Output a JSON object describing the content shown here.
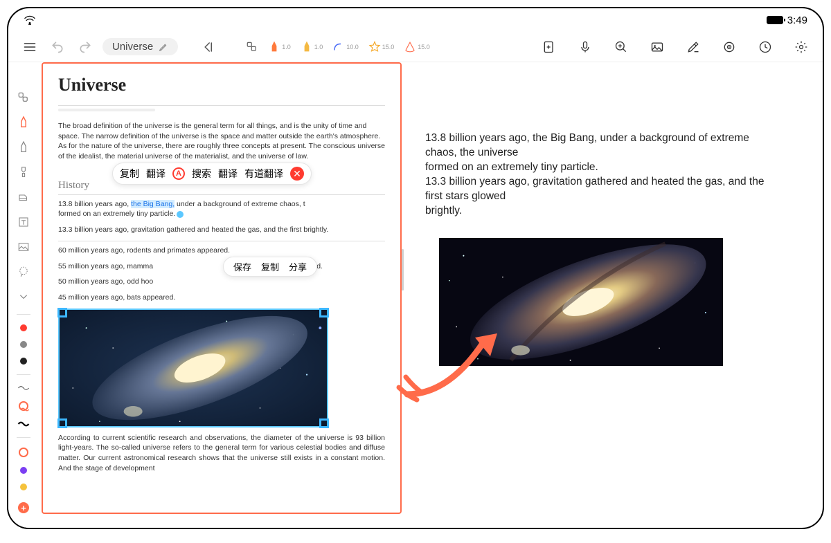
{
  "status": {
    "time": "3:49"
  },
  "doc": {
    "title": "Universe"
  },
  "toolSizes": {
    "pen1": "1.0",
    "pen2": "1.0",
    "curve": "10.0",
    "star": "15.0",
    "cone": "15.0"
  },
  "page": {
    "h1": "Universe",
    "intro": "The broad definition of the universe is the general term for all things, and is the unity of time and space. The narrow definition of the universe is the space and matter outside the earth's atmosphere. As for the nature of the universe, there are roughly three concepts at present. The conscious universe of the idealist, the material universe of the materialist, and the universe of law.",
    "h2": "History",
    "p1a": "13.8 billion years ago, ",
    "p1link": "the Big Bang,",
    "p1b": " under a background of extreme chaos, t",
    "p1c": "formed on an extremely tiny particle.",
    "p2": "13.3 billion years ago, gravitation gathered and heated the gas, and the first brightly.",
    "t1": "60 million years ago, rodents and primates appeared.",
    "t2a": "55 million years ago, mamma",
    "t2b": "ared, cetaceans appeared.",
    "t3": "50 million years ago, odd hoo",
    "t4": "45 million years ago, bats appeared.",
    "foot": "According to current scientific research and observations, the diameter of the universe is 93 billion light-years. The so-called universe refers to the general term for various celestial bodies and diffuse matter. Our current astronomical research shows that the universe still exists in a constant motion. And the stage of development"
  },
  "ctx1": {
    "copy": "复制",
    "translate": "翻译",
    "search": "搜索",
    "translate2": "翻译",
    "youdao": "有道翻译"
  },
  "ctx2": {
    "save": "保存",
    "copy": "复制",
    "share": "分享"
  },
  "right": {
    "l1": "13.8 billion years ago, the Big Bang, under a background of extreme chaos, the universe",
    "l2": "formed on an extremely tiny particle.",
    "l3": "13.3 billion years ago, gravitation gathered and heated the gas, and the first stars glowed",
    "l4": "brightly."
  }
}
